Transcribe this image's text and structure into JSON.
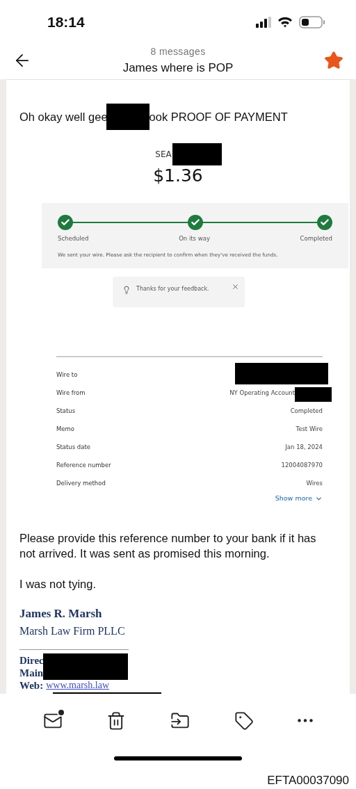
{
  "status_bar": {
    "time": "18:14"
  },
  "header": {
    "count": "8 messages",
    "title": "James where is POP",
    "starred": true
  },
  "message": {
    "intro_before": "Oh okay well gee",
    "intro_after": "ook PROOF OF PAYMENT",
    "currency_prefix": "SEA",
    "amount": "$1.36"
  },
  "tracker": {
    "steps": [
      {
        "label": "Scheduled",
        "done": true
      },
      {
        "label": "On its way",
        "done": true
      },
      {
        "label": "Completed",
        "done": true
      }
    ],
    "note": "We sent your wire. Please ask the recipient to confirm when they've received the funds."
  },
  "toast": {
    "text": "Thanks for your feedback."
  },
  "details": {
    "rows": [
      {
        "label": "Wire to",
        "redacted": true
      },
      {
        "label": "Wire from",
        "value": "NY Operating Account",
        "redacted": true
      },
      {
        "label": "Status",
        "value": "Completed",
        "redacted": false
      },
      {
        "label": "Memo",
        "value": "Test Wire",
        "redacted": false
      },
      {
        "label": "Status date",
        "value": "Jan 18, 2024",
        "redacted": false
      },
      {
        "label": "Reference number",
        "value": "12004087970",
        "redacted": false
      },
      {
        "label": "Delivery method",
        "value": "Wires",
        "redacted": false
      }
    ],
    "show_more": "Show more"
  },
  "body": [
    "Please provide this reference number to your bank if it has not arrived. It was sent as promised this morning.",
    "I was not tying."
  ],
  "signature": {
    "name": "James R. Marsh",
    "firm": "Marsh Law Firm PLLC",
    "lines": [
      {
        "label": "Direc",
        "kind": "redacted"
      },
      {
        "label": "Main",
        "kind": "redacted"
      },
      {
        "label": "Web:",
        "kind": "link",
        "link": "www.marsh.law"
      },
      {
        "kind": "redacted"
      }
    ]
  },
  "toolbar": [
    {
      "kind": "unread",
      "badge": true
    },
    {
      "kind": "delete"
    },
    {
      "kind": "move"
    },
    {
      "kind": "tag"
    },
    {
      "kind": "more"
    }
  ],
  "document_id": "EFTA00037090"
}
